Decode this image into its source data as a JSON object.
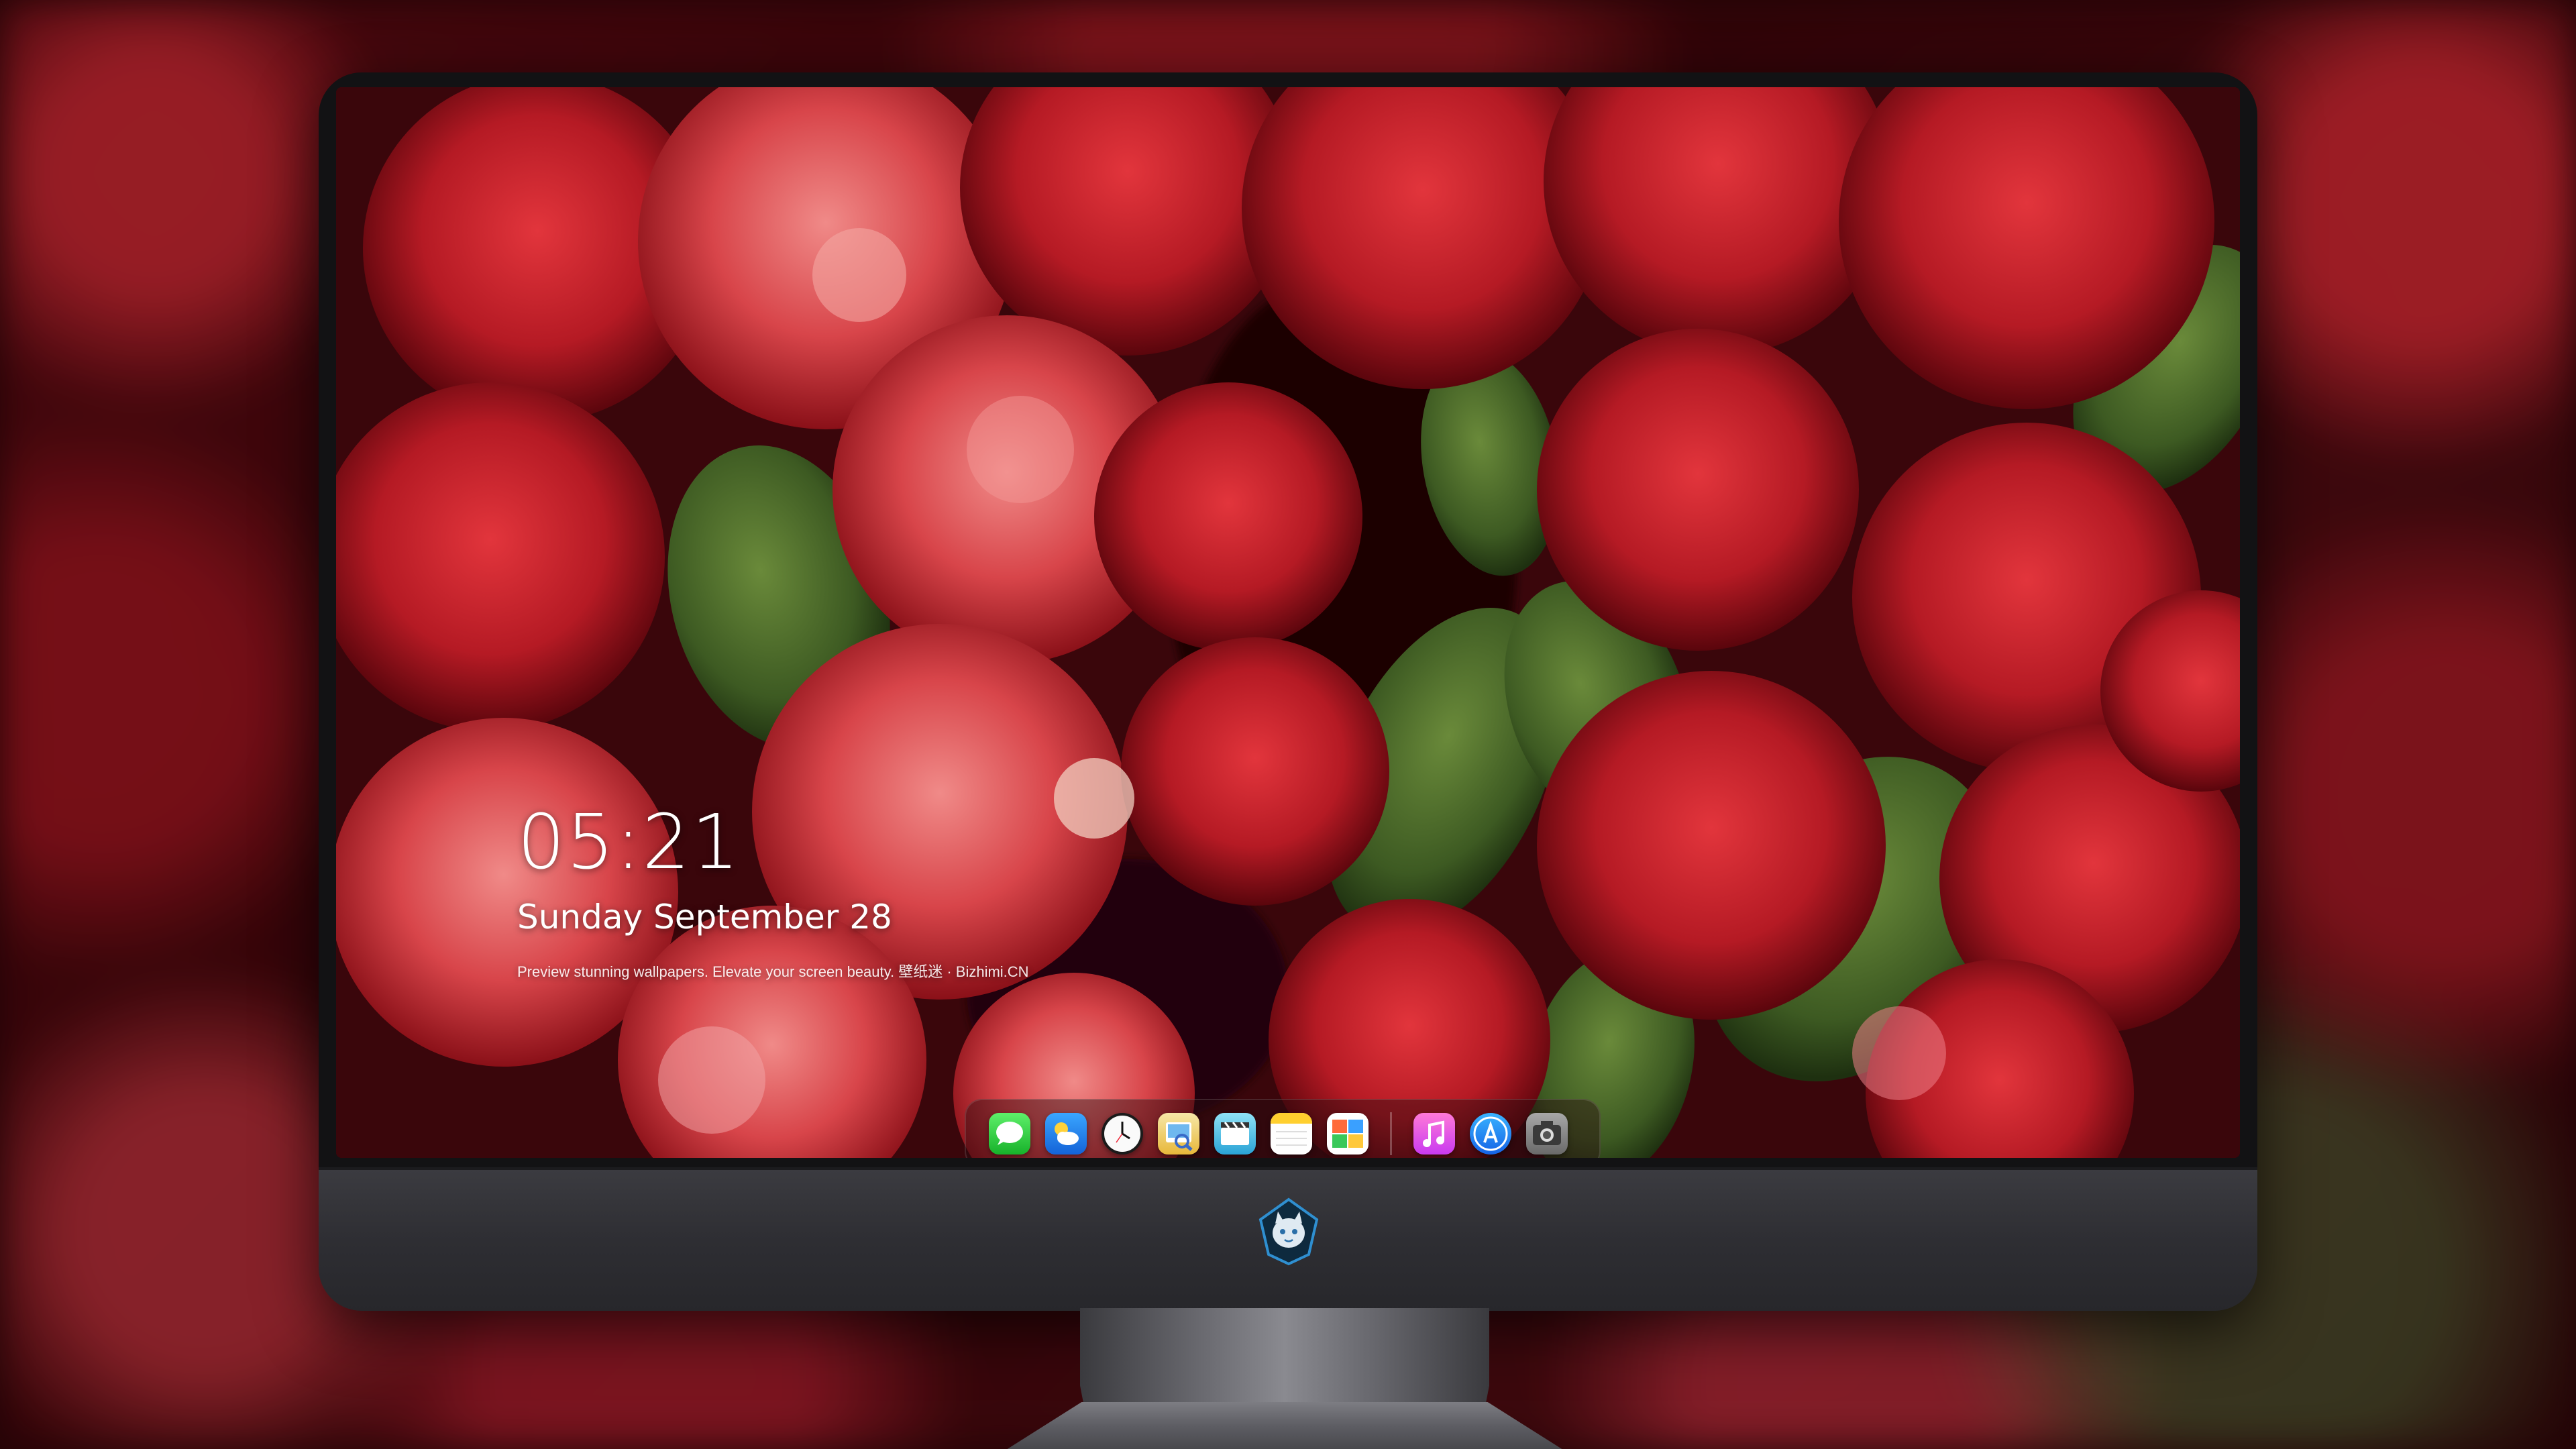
{
  "lock_screen": {
    "time": "05:21",
    "date": "Sunday September  28",
    "tagline": "Preview stunning wallpapers. Elevate your screen beauty. 壁纸迷 · Bizhimi.CN"
  },
  "dock": {
    "apps": [
      {
        "name": "messages-app-icon",
        "color": "#2ecc40"
      },
      {
        "name": "weather-app-icon",
        "color": "#1e90ff"
      },
      {
        "name": "clock-app-icon",
        "color": "#ffffff"
      },
      {
        "name": "preview-app-icon",
        "color": "#f0c040"
      },
      {
        "name": "video-app-icon",
        "color": "#56c8e8"
      },
      {
        "name": "notes-app-icon",
        "color": "#ffd84a"
      },
      {
        "name": "photo-booth-app-icon",
        "color": "#46a0f0"
      },
      {
        "name": "music-app-icon",
        "color": "#f04bc0"
      },
      {
        "name": "app-store-app-icon",
        "color": "#1a8cff"
      },
      {
        "name": "camera-app-icon",
        "color": "#8a8a8a"
      }
    ]
  }
}
